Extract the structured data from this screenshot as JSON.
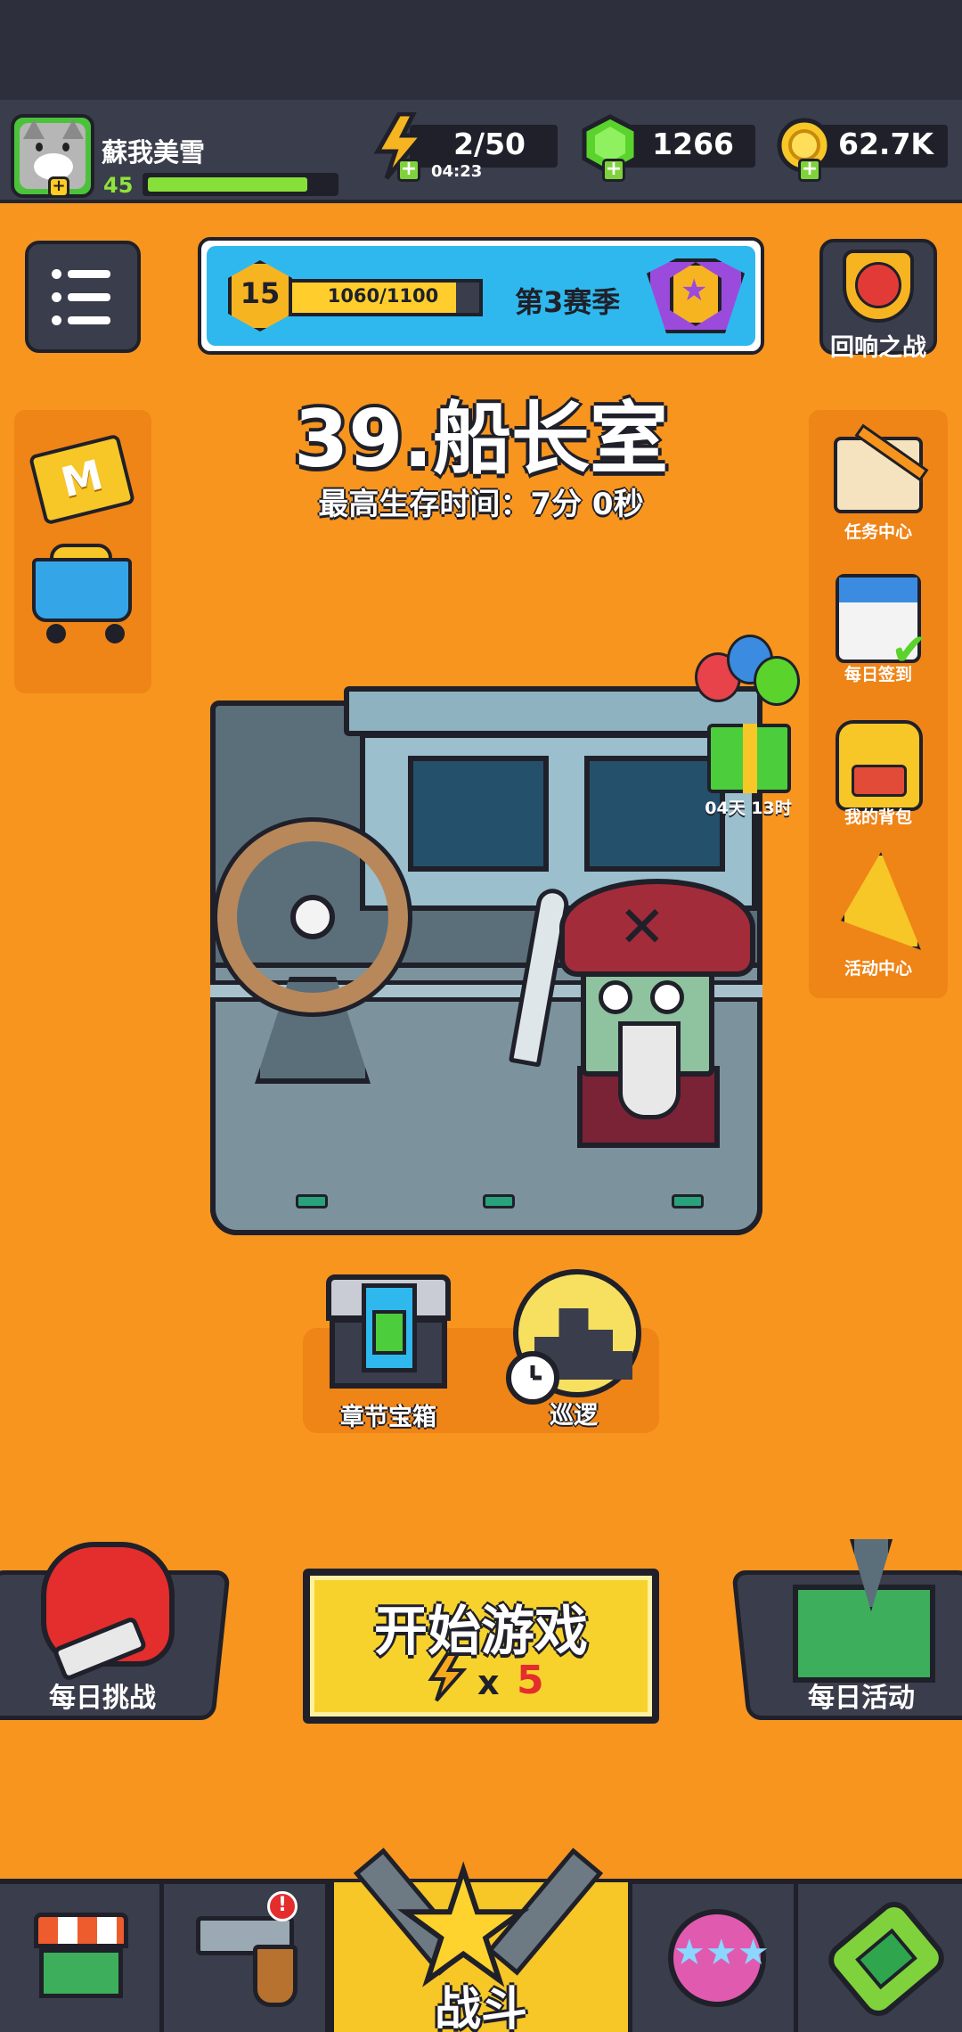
{
  "player": {
    "name": "蘇我美雪",
    "level": "45",
    "xp_fraction": 0.85
  },
  "resources": {
    "energy": "2/50",
    "energy_timer": "04:23",
    "gems": "1266",
    "coins": "62.7K"
  },
  "season": {
    "level": "15",
    "progress": "1060/1100",
    "name": "第3赛季"
  },
  "echo_battle": {
    "label": "回响之战"
  },
  "stage": {
    "title": "39.船长室",
    "best_survival": "最高生存时间：7分 0秒"
  },
  "left_side": {
    "items": [
      {
        "icon": "m-card-icon",
        "letter": "M"
      },
      {
        "icon": "shop-cart-icon"
      }
    ]
  },
  "right_side": {
    "items": [
      {
        "label": "任务中心",
        "icon": "scroll-pencil-icon"
      },
      {
        "label": "每日签到",
        "icon": "calendar-check-icon"
      },
      {
        "label": "我的背包",
        "icon": "backpack-icon"
      },
      {
        "label": "活动中心",
        "icon": "party-popper-icon"
      }
    ]
  },
  "gift": {
    "timer": "04天 13时"
  },
  "mini": {
    "chest_label": "章节宝箱",
    "patrol_label": "巡逻"
  },
  "actions": {
    "daily_challenge": "每日挑战",
    "daily_activity": "每日活动",
    "start_label": "开始游戏",
    "start_cost_x": "x",
    "start_cost": "5"
  },
  "nav": {
    "items": [
      {
        "icon": "shop-icon"
      },
      {
        "icon": "gun-icon",
        "badge": "!"
      },
      {
        "icon": "battle-star-icon",
        "label": "战斗"
      },
      {
        "icon": "star-orb-icon"
      },
      {
        "icon": "dna-capsule-icon"
      }
    ]
  },
  "colors": {
    "background": "#f7951f",
    "panel_dark": "#3a3d4b",
    "accent_yellow": "#f7d22d",
    "energy_green": "#87e03a"
  }
}
